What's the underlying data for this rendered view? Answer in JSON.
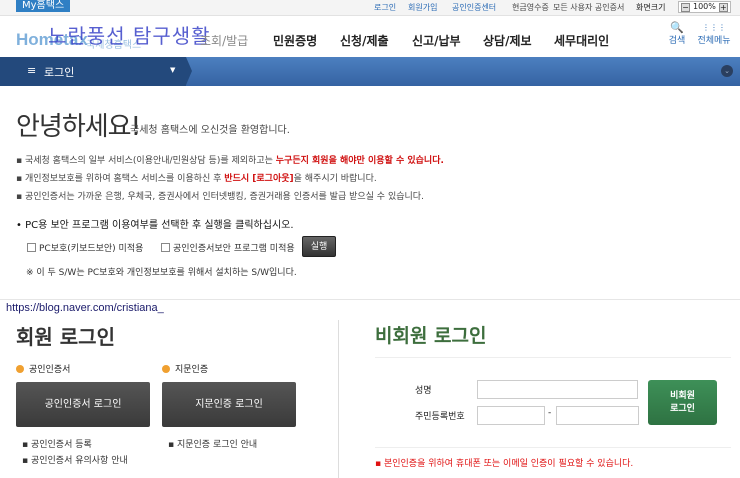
{
  "topbar": {
    "my_tab": "My홈택스",
    "links": [
      "로그인",
      "회원가입",
      "공인인증센터",
      "현금영수증",
      "모든 사용자 공인증서"
    ],
    "font_size_label": "화면크기",
    "zoom_value": "100%",
    "zoom_minus": "−",
    "zoom_plus": "+"
  },
  "logo": {
    "brand": "Hometax",
    "sub": "국세청홈택스",
    "watermark": "노란풍선 탐구생활"
  },
  "nav": [
    "조회/발급",
    "민원증명",
    "신청/제출",
    "신고/납부",
    "상담/제보",
    "세무대리인"
  ],
  "header_icons": {
    "search": "검색",
    "all_menu": "전체메뉴",
    "search_glyph": "🔍",
    "menu_glyph": "⋮⋮⋮"
  },
  "menubar": {
    "label": "로그인",
    "menu_glyph": "≡",
    "caret": "▼",
    "expand": "⌄"
  },
  "welcome": {
    "title": "안녕하세요!",
    "subtitle": "국세청 홈택스에 오신것을 환영합니다."
  },
  "bullets": [
    {
      "text": "국세청 홈택스의 일부 서비스(이용안내/민원상담 등)를 제외하고는 ",
      "red": "누구든지 회원을 해야만 이용할 수 있습니다."
    },
    {
      "text": "개인정보보호를 위하여 홈택스 서비스를 이용하신 후 ",
      "red": "반드시 [로그아웃]",
      "tail": "을 해주시기 바랍니다."
    },
    {
      "text": "공인인증서는 가까운 은행, 우체국, 증권사에서 인터넷뱅킹, 증권거래용 인증서를 발급 받으실 수 있습니다."
    }
  ],
  "pc_security": {
    "question": "• PC용 보안 프로그램 이용여부를 선택한 후 실행을 클릭하십시오.",
    "option1": "PC보호(키보드보안) 미적용",
    "option2": "공인인증서보안 프로그램 미적용",
    "run": "실행",
    "note": "※ 이 두 S/W는 PC보호와 개인정보보호를 위해서 설치하는 S/W입니다."
  },
  "watermark_url": "https://blog.naver.com/cristiana_",
  "member": {
    "title": "회원 로그인",
    "sec1": "공인인증서",
    "sec2": "지문인증",
    "btn1": "공인인증서 로그인",
    "btn2": "지문인증 로그인",
    "link1": "▪ 공인인증서 등록",
    "link2": "▪ 공인인증서 유의사항 안내",
    "link3": "▪ 지문인증 로그인 안내"
  },
  "nonmember": {
    "title": "비회원 로그인",
    "name_label": "성명",
    "rrn_label": "주민등록번호",
    "dash": "-",
    "button_line1": "비회원",
    "button_line2": "로그인",
    "note": "▪ 본인인증을 위하여 휴대폰 또는 이메일 인증이 필요할 수 있습니다."
  }
}
